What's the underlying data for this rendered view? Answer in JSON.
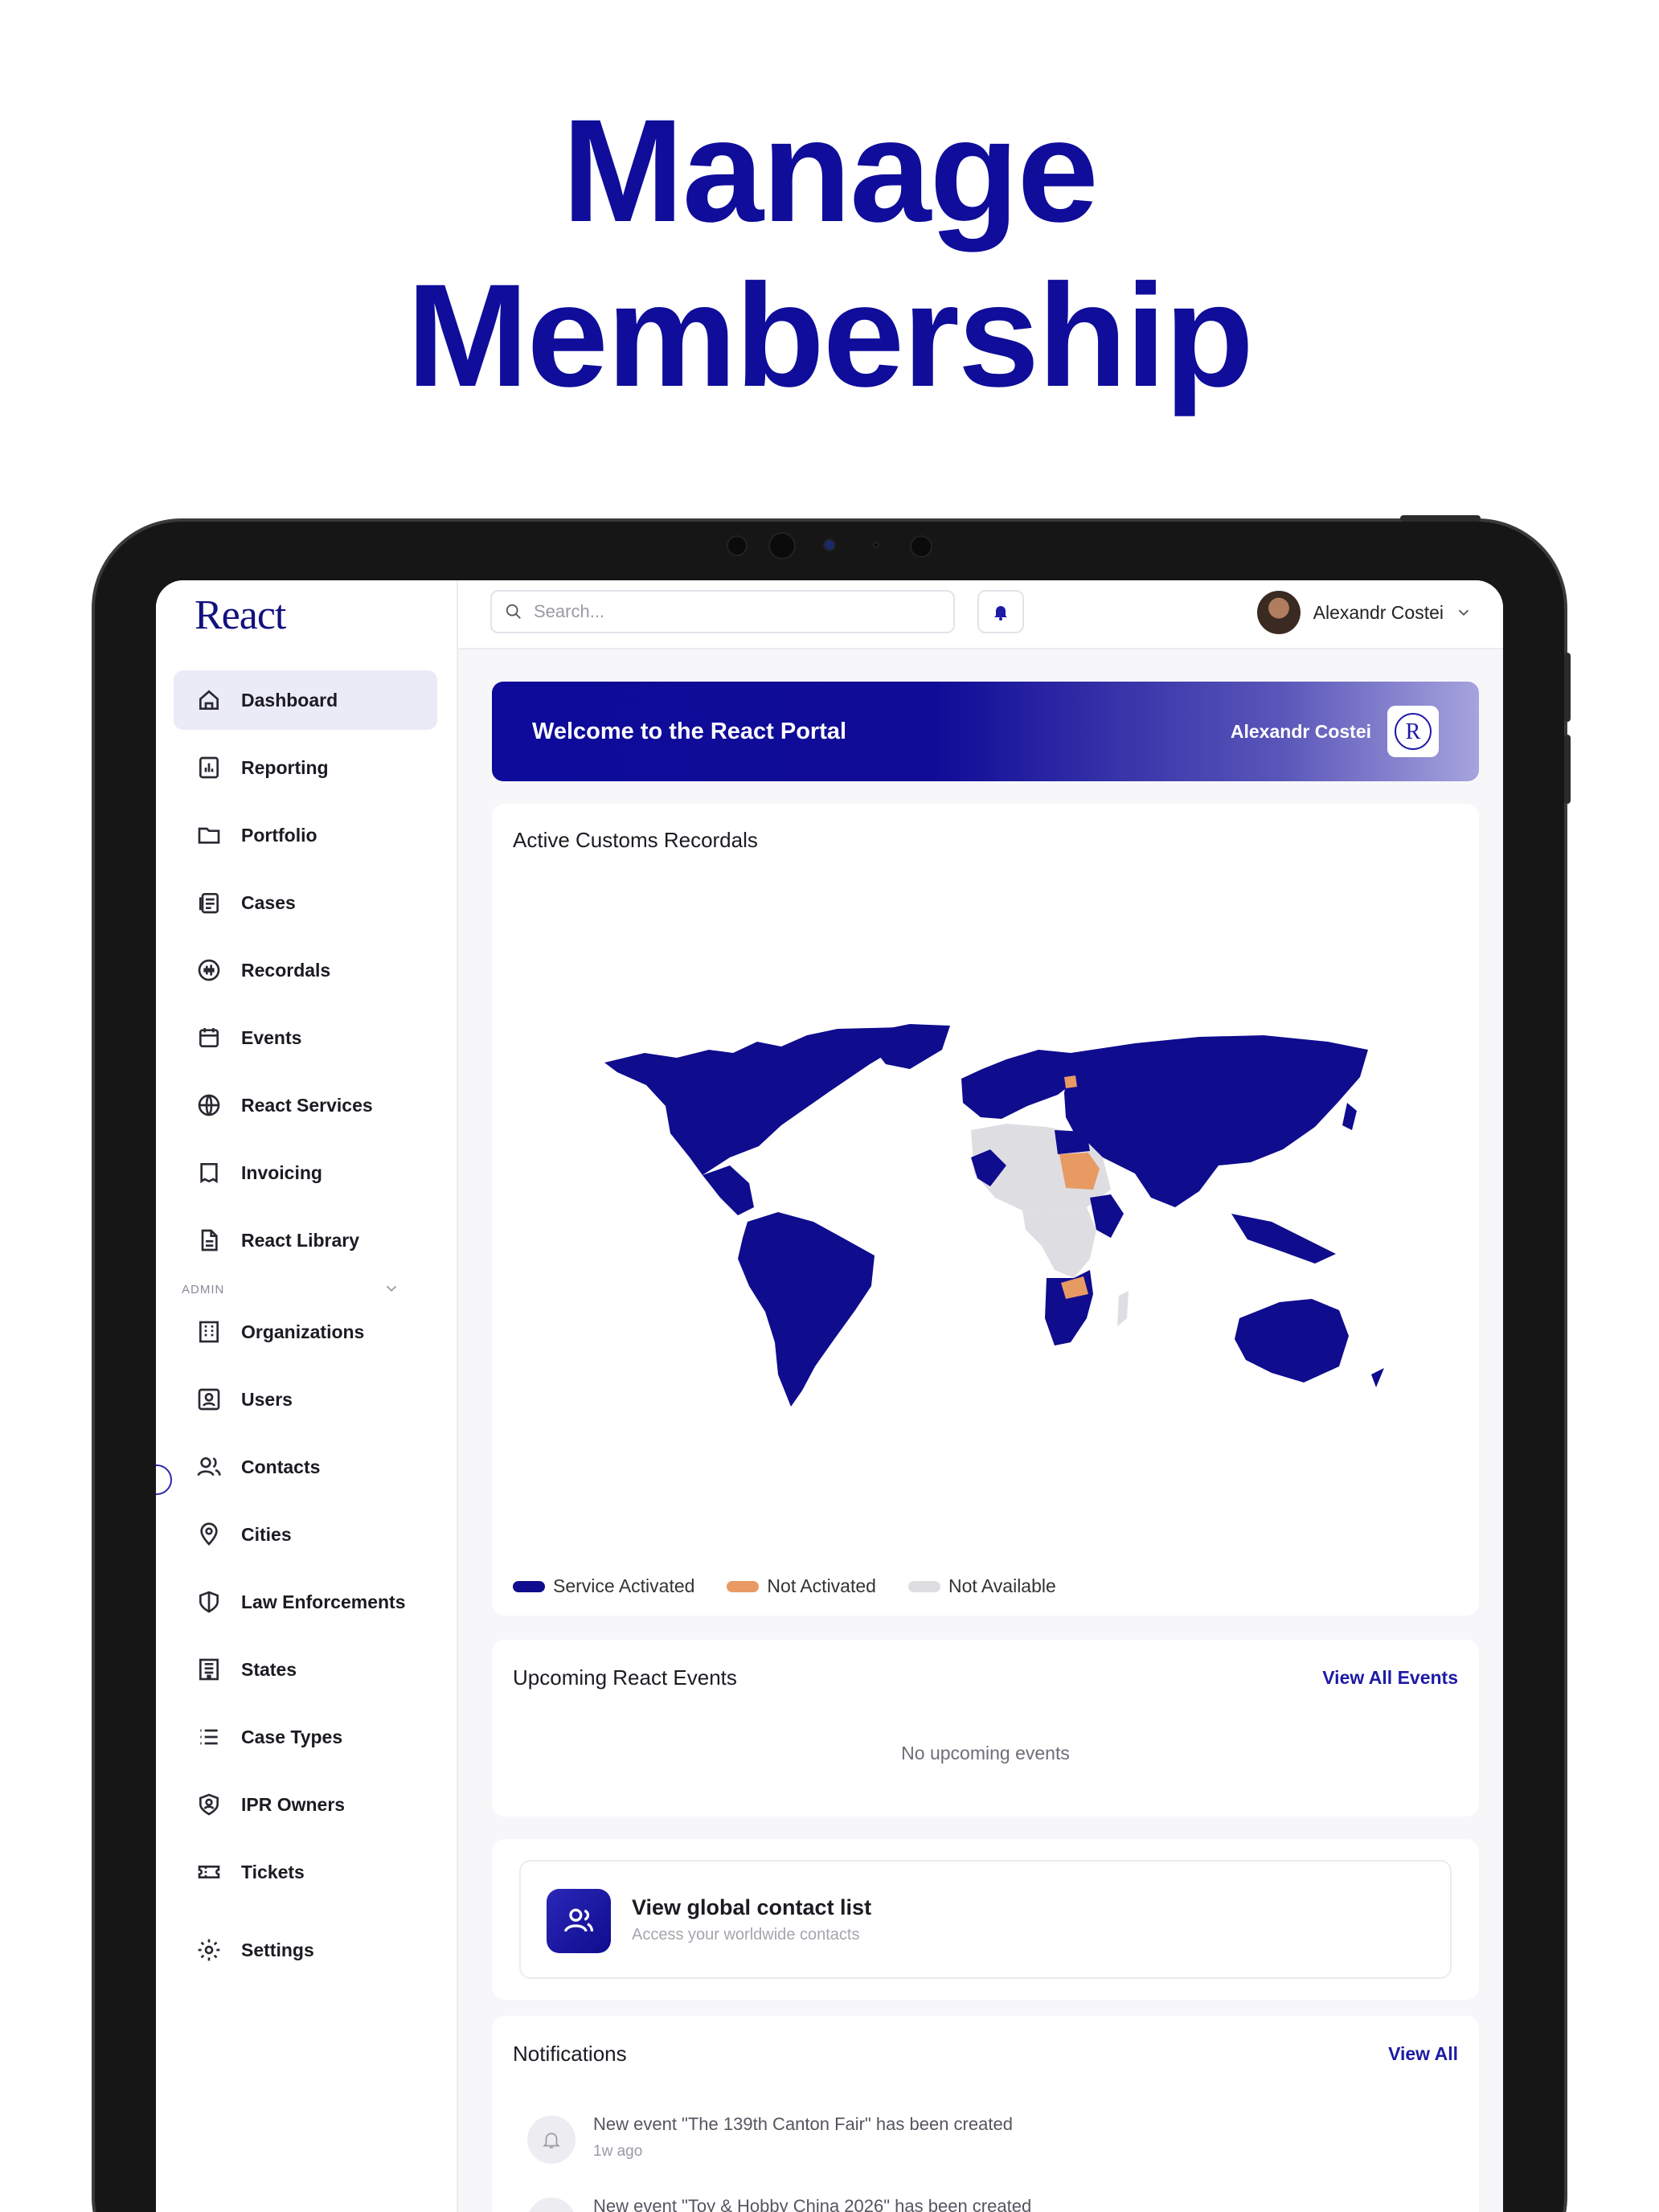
{
  "headline": {
    "line1": "Manage",
    "line2": "Membership"
  },
  "app": {
    "logo": "React",
    "search_placeholder": "Search...",
    "user_name": "Alexandr Costei"
  },
  "sidebar": {
    "items": [
      {
        "label": "Dashboard",
        "icon": "home-icon",
        "active": true
      },
      {
        "label": "Reporting",
        "icon": "bar-chart-icon"
      },
      {
        "label": "Portfolio",
        "icon": "folder-icon"
      },
      {
        "label": "Cases",
        "icon": "cases-icon"
      },
      {
        "label": "Recordals",
        "icon": "waveform-icon"
      },
      {
        "label": "Events",
        "icon": "calendar-icon"
      },
      {
        "label": "React Services",
        "icon": "globe-icon"
      },
      {
        "label": "Invoicing",
        "icon": "receipt-icon"
      },
      {
        "label": "React Library",
        "icon": "document-icon"
      }
    ],
    "admin_label": "ADMIN",
    "admin_items": [
      {
        "label": "Organizations",
        "icon": "building-icon"
      },
      {
        "label": "Users",
        "icon": "user-square-icon"
      },
      {
        "label": "Contacts",
        "icon": "users-icon"
      },
      {
        "label": "Cities",
        "icon": "map-pin-icon"
      },
      {
        "label": "Law Enforcements",
        "icon": "shield-icon"
      },
      {
        "label": "States",
        "icon": "state-building-icon"
      },
      {
        "label": "Case Types",
        "icon": "list-icon"
      },
      {
        "label": "IPR Owners",
        "icon": "shield-user-icon"
      },
      {
        "label": "Tickets",
        "icon": "ticket-icon"
      }
    ],
    "settings_label": "Settings"
  },
  "welcome": {
    "title": "Welcome to the React Portal",
    "user": "Alexandr Costei",
    "badge_letter": "R"
  },
  "map_card": {
    "title": "Active Customs Recordals",
    "legend": [
      {
        "label": "Service Activated",
        "color": "#0f0c8e"
      },
      {
        "label": "Not Activated",
        "color": "#e89a63"
      },
      {
        "label": "Not Available",
        "color": "#dedee2"
      }
    ]
  },
  "events_card": {
    "title": "Upcoming React Events",
    "link": "View All Events",
    "empty": "No upcoming events"
  },
  "contact_card": {
    "title": "View global contact list",
    "subtitle": "Access your worldwide contacts"
  },
  "notifications": {
    "title": "Notifications",
    "link": "View All",
    "items": [
      {
        "text": "New event \"The 139th Canton Fair\" has been created",
        "time": "1w ago"
      },
      {
        "text": "New event \"Toy & Hobby China 2026\" has been created",
        "time": ""
      }
    ]
  },
  "colors": {
    "brand": "#0f0d9a",
    "accent": "#1d1aa5",
    "not_activated": "#e89a63",
    "not_available": "#dedee2"
  }
}
